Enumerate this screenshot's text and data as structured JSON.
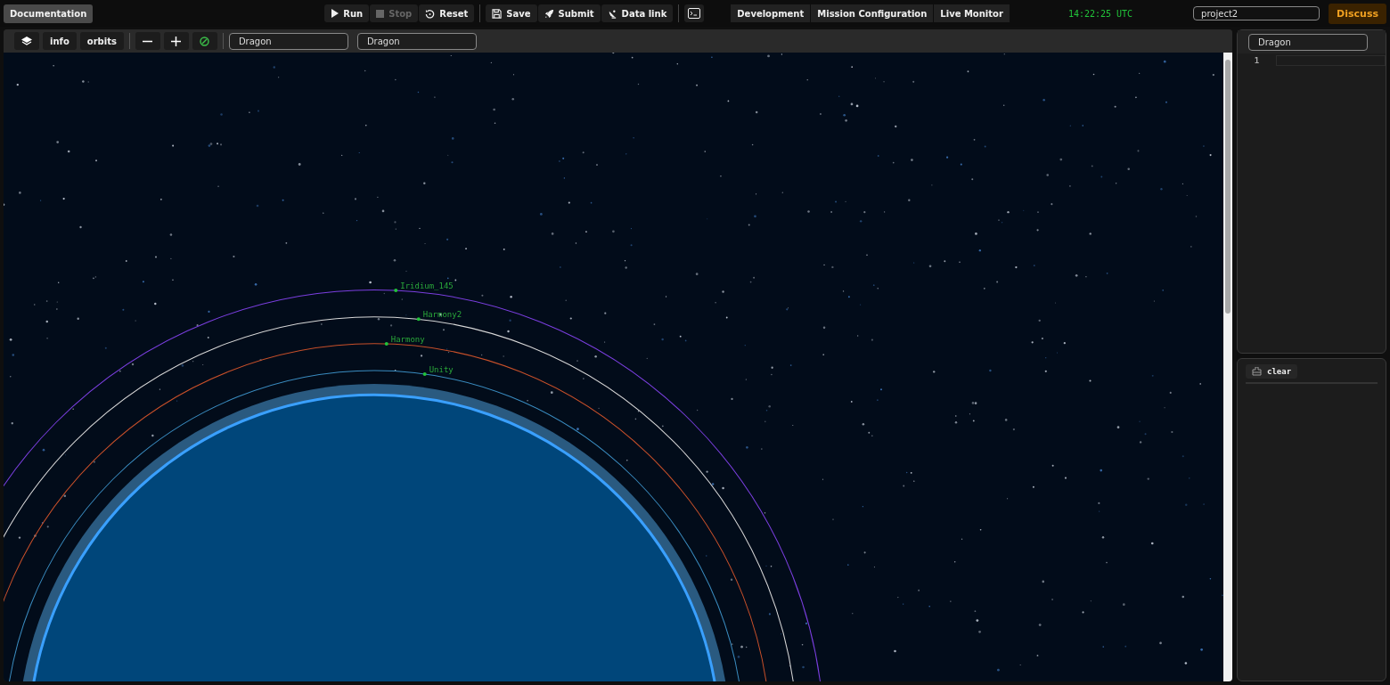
{
  "topbar": {
    "docs_button": "Documentation",
    "actions": [
      {
        "label": "Run",
        "disabled": false
      },
      {
        "label": "Stop",
        "disabled": true
      },
      {
        "label": "Reset",
        "disabled": false
      }
    ],
    "file_actions": [
      {
        "label": "Save"
      },
      {
        "label": "Submit"
      },
      {
        "label": "Data link"
      }
    ],
    "nav_tabs": [
      "Development",
      "Mission Configuration",
      "Live Monitor"
    ],
    "clock": "14:22:25 UTC",
    "project_field": {
      "value": "project2"
    },
    "discuss_button": "Discuss"
  },
  "map_toolbar": {
    "buttons": [
      "info",
      "orbits"
    ],
    "selects": [
      {
        "value": "Dragon"
      },
      {
        "value": "Dragon"
      }
    ]
  },
  "satellites": [
    {
      "name": "Iridium_145",
      "color": "#7b3fe0"
    },
    {
      "name": "Harmony2",
      "color": "#d8d8d8"
    },
    {
      "name": "Harmony",
      "color": "#c8502a"
    },
    {
      "name": "Unity",
      "color": "#3a8cc0"
    }
  ],
  "side_panel": {
    "select": {
      "value": "Dragon"
    },
    "editor_lines": [
      "1"
    ],
    "console_button": "clear"
  }
}
